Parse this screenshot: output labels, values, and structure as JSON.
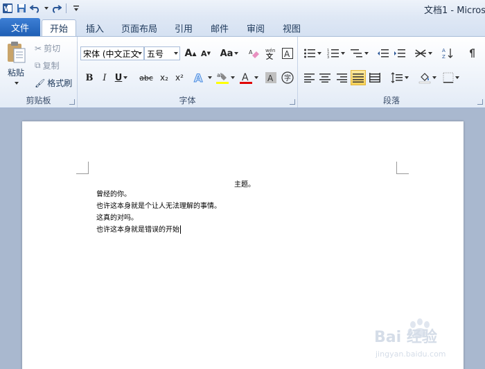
{
  "titlebar": {
    "doc_title": "文档1 - Micros"
  },
  "tabs": {
    "file": "文件",
    "items": [
      "开始",
      "插入",
      "页面布局",
      "引用",
      "邮件",
      "审阅",
      "视图"
    ],
    "active_index": 0
  },
  "clipboard": {
    "paste": "粘贴",
    "cut": "剪切",
    "copy": "复制",
    "format_painter": "格式刷",
    "group_label": "剪贴板"
  },
  "font": {
    "font_name": "宋体 (中文正文",
    "font_size": "五号",
    "grow": "A",
    "shrink": "A",
    "change_case": "Aa",
    "bold": "B",
    "italic": "I",
    "underline": "U",
    "strike": "abc",
    "subscript": "x₂",
    "superscript": "x²",
    "group_label": "字体"
  },
  "paragraph": {
    "group_label": "段落"
  },
  "document": {
    "lines": [
      "主题。",
      "曾经的你。",
      "也许这本身就是个让人无法理解的事情。",
      "这真的对吗。",
      "也许这本身就是错误的开始"
    ]
  },
  "watermark": {
    "text": "Bai 经验",
    "url": "jingyan.baidu.com"
  },
  "colors": {
    "accent": "#2b6cc4",
    "highlight": "#f9d25a",
    "font_color_bar": "#e00000",
    "highlight_bar": "#ffff00"
  }
}
